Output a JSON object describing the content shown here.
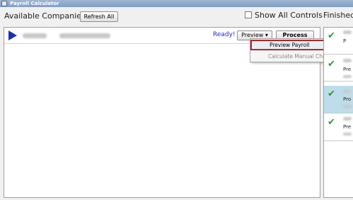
{
  "window": {
    "title": "Payroll Calculator"
  },
  "toolbar": {
    "available_label": "Available Companies",
    "refresh_label": "Refresh All",
    "show_all_label": "Show All Controls",
    "show_all_checked": false,
    "finished_label": "Finished"
  },
  "company_row": {
    "status": "Ready!",
    "preview_label": "Preview ▾",
    "process_label": "Process"
  },
  "dropdown": {
    "items": [
      {
        "label": "Preview Payroll",
        "enabled": true
      },
      {
        "label": "Calculate Manual Checks",
        "enabled": false
      }
    ]
  },
  "finished": {
    "rows": [
      {
        "text": "P"
      },
      {
        "text": "Pre"
      },
      {
        "text": "Pro"
      },
      {
        "text": "Pre"
      }
    ]
  },
  "colors": {
    "accent_blue": "#1b2ad3",
    "check_green": "#2e9a2e",
    "highlight_red": "#b3252a"
  }
}
